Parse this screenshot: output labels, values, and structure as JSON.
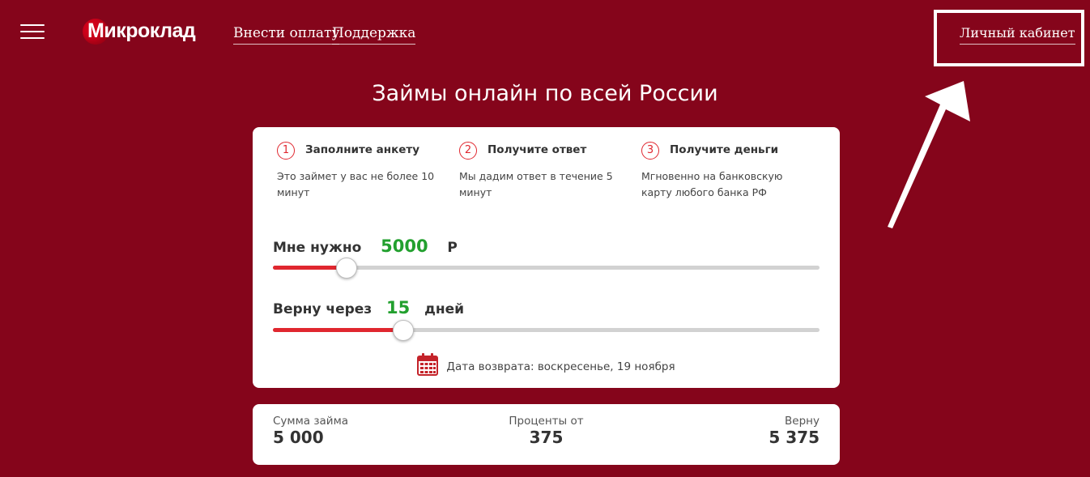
{
  "header": {
    "logo_text": "Микроклад",
    "nav": {
      "pay_label": "Внести оплату",
      "support_label": "Поддержка"
    },
    "cabinet_label": "Личный кабинет"
  },
  "main": {
    "title": "Займы онлайн по всей России",
    "steps": [
      {
        "num": "1",
        "title": "Заполните анкету",
        "desc": "Это займет у вас не более 10 минут"
      },
      {
        "num": "2",
        "title": "Получите ответ",
        "desc": "Мы дадим ответ в течение 5 минут"
      },
      {
        "num": "3",
        "title": "Получите деньги",
        "desc": "Мгновенно на банковскую карту любого банка РФ"
      }
    ],
    "amount": {
      "label": "Мне нужно",
      "value": "5000",
      "currency": "Р",
      "fill_fraction": 0.133
    },
    "term": {
      "label": "Верну через",
      "value": "15",
      "unit": "дней",
      "fill_fraction": 0.237
    },
    "return_date": "Дата возврата: воскресенье, 19 ноября"
  },
  "summary": {
    "loan_label": "Сумма займа",
    "loan_value": "5 000",
    "interest_label": "Проценты от",
    "interest_value": "375",
    "return_label": "Верну",
    "return_value": "5 375"
  },
  "colors": {
    "background": "#85051b",
    "accent_red": "#e0272f",
    "value_green": "#22a02e"
  },
  "icons": {
    "menu": "hamburger-menu-icon",
    "calendar": "calendar-icon",
    "annotation": "arrow-pointer-icon"
  }
}
